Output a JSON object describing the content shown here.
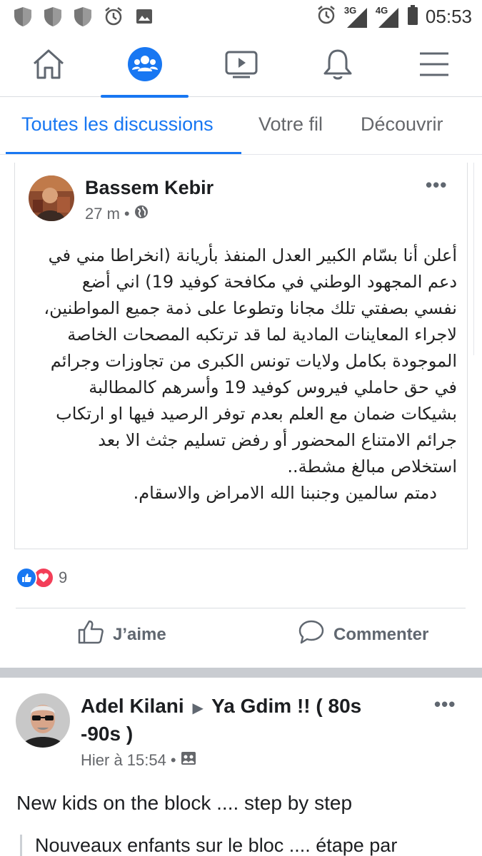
{
  "status_bar": {
    "time": "05:53",
    "network_left": "3G",
    "network_right": "4G",
    "icons": [
      "shield-icon",
      "shield-icon",
      "shield-icon",
      "alarm-icon",
      "image-icon",
      "alarm-icon",
      "signal-icon",
      "signal-icon",
      "battery-icon"
    ]
  },
  "navbar": {
    "items": [
      "home-icon",
      "groups-icon",
      "watch-icon",
      "notifications-icon",
      "menu-icon"
    ],
    "active_index": 1
  },
  "tabs": {
    "items": [
      {
        "label": "Toutes les discussions"
      },
      {
        "label": "Votre fil"
      },
      {
        "label": "Découvrir"
      }
    ],
    "active_index": 0
  },
  "post1": {
    "author": "Bassem Kebir",
    "time": "27 m",
    "audience_icon": "globe-icon",
    "more_label": "•••",
    "text_lines": [
      "أعلن أنا بسّام الكبير  العدل المنفذ بأريانة (انخراطا مني في",
      "دعم المجهود الوطني في مكافحة كوفيد 19) اني أضع",
      "نفسي بصفتي تلك مجانا وتطوعا على ذمة جميع المواطنين،",
      "لاجراء المعاينات المادية لما قد ترتكبه المصحات الخاصة",
      "الموجودة بكامل ولايات تونس الكبرى من تجاوزات وجرائم",
      "في حق حاملي فيروس كوفيد 19 وأسرهم كالمطالبة",
      "بشيكات ضمان مع العلم بعدم توفر الرصيد فيها او ارتكاب",
      "جرائم الامتناع المحضور أو رفض تسليم جثث الا بعد",
      "استخلاص مبالغ مشطة..",
      "دمتم سالمين وجنبنا الله الامراض والاسقام."
    ],
    "reactions": {
      "count": "9",
      "types": [
        "like",
        "love"
      ]
    },
    "actions": {
      "like_label": "J’aime",
      "comment_label": "Commenter"
    }
  },
  "post2": {
    "author": "Adel Kilani",
    "arrow": "▶",
    "group": "Ya Gdim !! ( 80s -90s )",
    "time": "Hier à 15:54",
    "more_label": "•••",
    "caption": "New kids on the block .... step by step",
    "quote": "Nouveaux enfants sur le bloc .... étape par"
  },
  "colors": {
    "accent": "#1877f2",
    "love": "#f33e58",
    "muted": "#65676b",
    "separator": "#c9ccd1"
  }
}
